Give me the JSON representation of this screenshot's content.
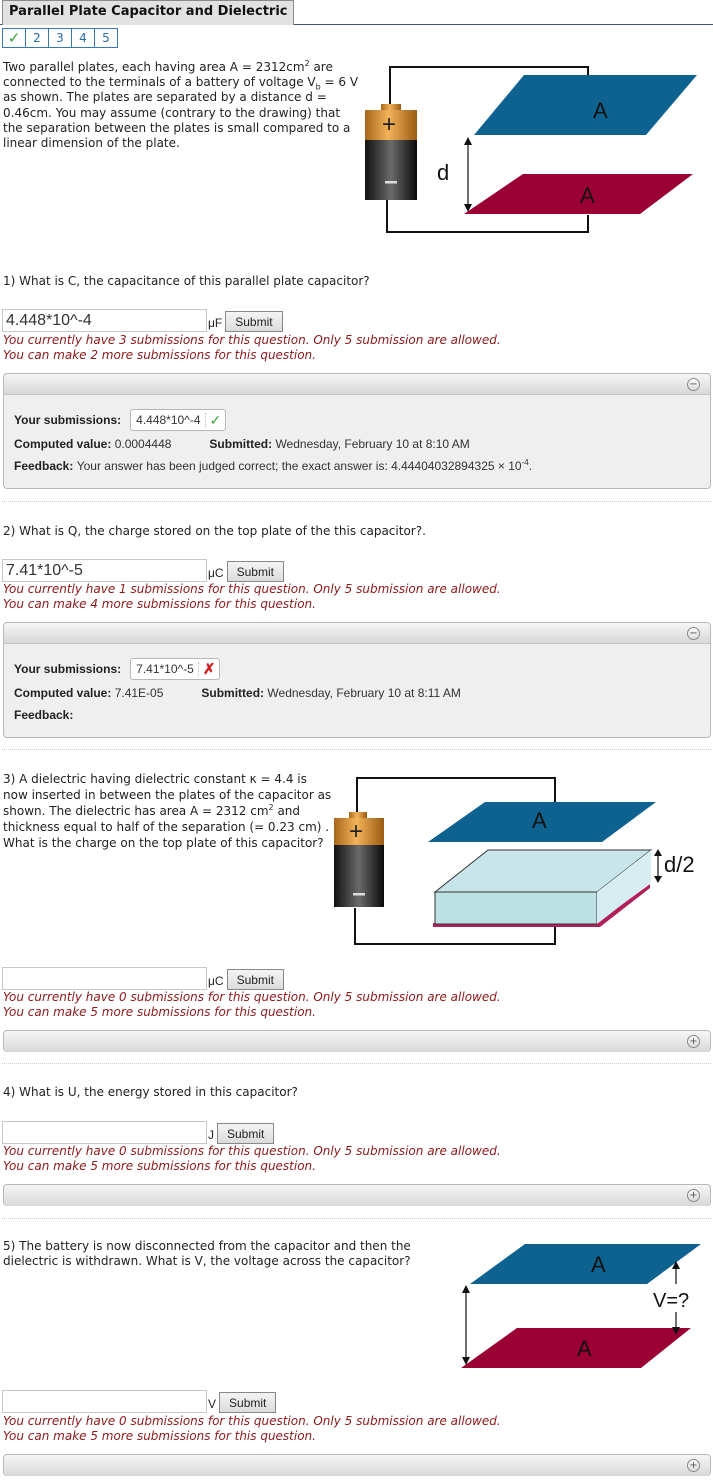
{
  "header": {
    "title": "Parallel Plate Capacitor and Dielectric",
    "parts": [
      {
        "label": "✓",
        "status": "correct"
      },
      {
        "label": "2"
      },
      {
        "label": "3"
      },
      {
        "label": "4"
      },
      {
        "label": "5"
      }
    ]
  },
  "intro": {
    "text_1": "Two parallel plates, each having area A = 2312cm",
    "sup_1": "2",
    "text_2": " are connected to the terminals of a battery of voltage V",
    "sub_1": "b",
    "text_3": " = 6 V as shown. The plates are separated by a distance d = 0.46cm. You may assume (contrary to the drawing) that the separation between the plates is small compared to a linear dimension of the plate."
  },
  "diagram_labels": {
    "plate": "A",
    "plus": "+",
    "minus": "−",
    "d": "d",
    "d_half": "d/2",
    "v_unknown": "V=?"
  },
  "questions": [
    {
      "prompt": "1) What is C, the capacitance of this parallel plate capacitor?",
      "value": "4.448*10^-4",
      "unit": "μF",
      "submit": "Submit",
      "msg_1": "You currently have 3 submissions for this question. Only 5 submission are allowed.",
      "msg_2": "You can make 2 more submissions for this question.",
      "panel": {
        "expanded": true,
        "your_submissions_label": "Your submissions:",
        "submission": "4.448*10^-4",
        "result": "correct",
        "computed_label": "Computed value:",
        "computed": "0.0004448",
        "submitted_label": "Submitted:",
        "submitted": "Wednesday, February 10 at 8:10 AM",
        "feedback_label": "Feedback:",
        "feedback": "Your answer has been judged correct; the exact answer is: 4.44404032894325 × 10",
        "feedback_exp": "-4",
        "feedback_end": "."
      }
    },
    {
      "prompt": "2) What is Q, the charge stored on the top plate of the this capacitor?.",
      "value": "7.41*10^-5",
      "unit": "μC",
      "submit": "Submit",
      "msg_1": "You currently have 1 submissions for this question. Only 5 submission are allowed.",
      "msg_2": "You can make 4 more submissions for this question.",
      "panel": {
        "expanded": true,
        "your_submissions_label": "Your submissions:",
        "submission": "7.41*10^-5",
        "result": "incorrect",
        "computed_label": "Computed value:",
        "computed": "7.41E-05",
        "submitted_label": "Submitted:",
        "submitted": "Wednesday, February 10 at 8:11 AM",
        "feedback_label": "Feedback:",
        "feedback": ""
      }
    },
    {
      "prompt_1": "3) A dielectric having dielectric constant κ = 4.4 is now inserted in between the plates of the capacitor as shown. The dielectric has area A = 2312 cm",
      "prompt_sup": "2",
      "prompt_2": " and thickness equal to half of the separation (= 0.23 cm) . What is the charge on the top plate of this capacitor?",
      "value": "",
      "unit": "μC",
      "submit": "Submit",
      "msg_1": "You currently have 0 submissions for this question. Only 5 submission are allowed.",
      "msg_2": "You can make 5 more submissions for this question.",
      "panel": {
        "expanded": false
      }
    },
    {
      "prompt": "4) What is U, the energy stored in this capacitor?",
      "value": "",
      "unit": "J",
      "submit": "Submit",
      "msg_1": "You currently have 0 submissions for this question. Only 5 submission are allowed.",
      "msg_2": "You can make 5 more submissions for this question.",
      "panel": {
        "expanded": false
      }
    },
    {
      "prompt": "5) The battery is now disconnected from the capacitor and then the dielectric is withdrawn. What is V, the voltage across the capacitor?",
      "value": "",
      "unit": "V",
      "submit": "Submit",
      "msg_1": "You currently have 0 submissions for this question. Only 5 submission are allowed.",
      "msg_2": "You can make 5 more submissions for this question.",
      "panel": {
        "expanded": false
      }
    }
  ],
  "icons": {
    "collapse": "−",
    "expand": "+",
    "check": "✓",
    "cross": "✗"
  },
  "colors": {
    "top_plate": "#0e6290",
    "bottom_plate": "#9b0034",
    "dielectric": "#bde0e4",
    "message": "#8b1a1a",
    "correct": "#3aa336",
    "incorrect": "#d62020"
  }
}
